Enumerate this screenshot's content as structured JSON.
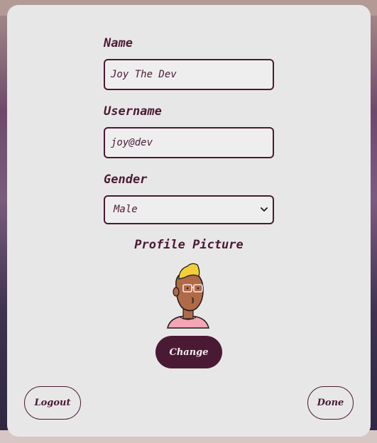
{
  "form": {
    "name_label": "Name",
    "name_value": "Joy The Dev",
    "username_label": "Username",
    "username_value": "joy@dev",
    "gender_label": "Gender",
    "gender_selected": "Male",
    "profile_picture_label": "Profile Picture"
  },
  "actions": {
    "change_label": "Change",
    "logout_label": "Logout",
    "done_label": "Done"
  },
  "colors": {
    "accent": "#4a1a34",
    "modal_bg": "#e8e7e7"
  },
  "icons": {
    "avatar": "avatar-illustration",
    "select_arrow": "chevron-down-icon"
  }
}
